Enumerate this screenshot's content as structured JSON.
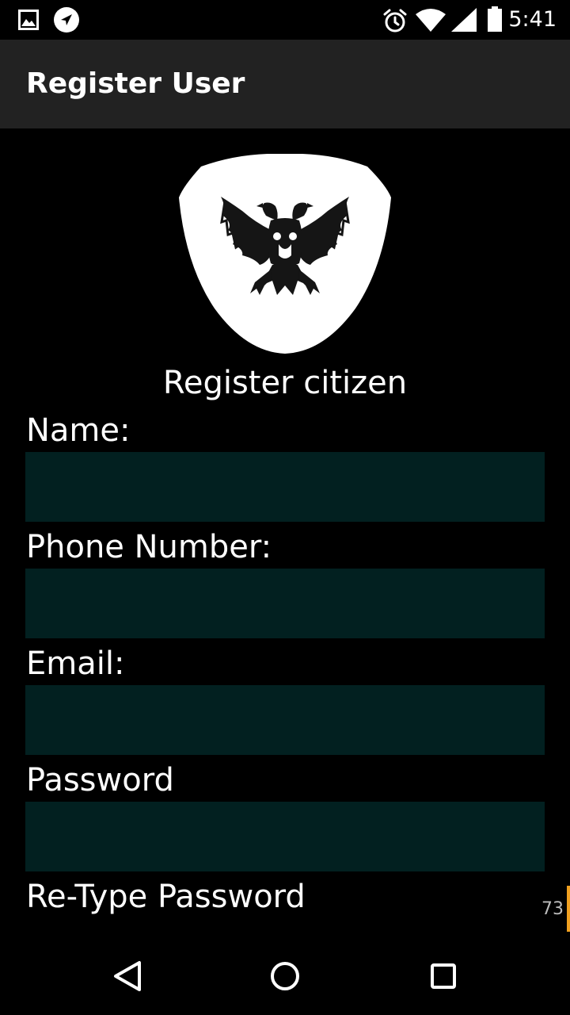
{
  "status_bar": {
    "time": "5:41",
    "icons": [
      "gallery-notification-icon",
      "navigation-notification-icon",
      "alarm-icon",
      "wifi-icon",
      "cellular-signal-icon",
      "battery-icon"
    ]
  },
  "app_bar": {
    "title": "Register User"
  },
  "form": {
    "heading": "Register citizen",
    "fields": [
      {
        "label": "Name:",
        "value": "",
        "placeholder": ""
      },
      {
        "label": "Phone Number:",
        "value": "",
        "placeholder": ""
      },
      {
        "label": "Email:",
        "value": "",
        "placeholder": ""
      },
      {
        "label": "Password",
        "value": "",
        "placeholder": ""
      },
      {
        "label": "Re-Type Password",
        "value": "",
        "placeholder": ""
      }
    ]
  },
  "scroll_counter": "73",
  "nav_bar": {
    "icons": [
      "back-icon",
      "home-icon",
      "recents-icon"
    ]
  },
  "colors": {
    "status_bar": "#000000",
    "app_bar": "#222222",
    "background": "#000000",
    "input_background": "#022020",
    "text": "#ffffff",
    "accent": "#f0a020"
  }
}
